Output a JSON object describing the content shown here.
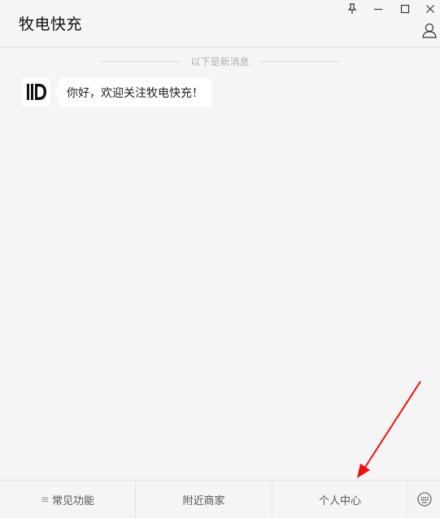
{
  "header": {
    "title": "牧电快充",
    "window_controls": [
      "pin-icon",
      "minimize-icon",
      "maximize-icon",
      "close-icon"
    ],
    "profile_icon": "person-icon"
  },
  "chat": {
    "divider_text": "以下是新消息",
    "messages": [
      {
        "avatar": "MD",
        "text": "你好，欢迎关注牧电快充！"
      }
    ]
  },
  "bottom_menu": {
    "menu_glyph": "≡",
    "items": [
      {
        "label": "常见功能"
      },
      {
        "label": "附近商家"
      },
      {
        "label": "个人中心"
      }
    ],
    "keyboard_icon": "keyboard-icon"
  },
  "colors": {
    "background": "#f5f5f5",
    "border": "#e4e4e4",
    "annotation_arrow": "#ee1111"
  }
}
